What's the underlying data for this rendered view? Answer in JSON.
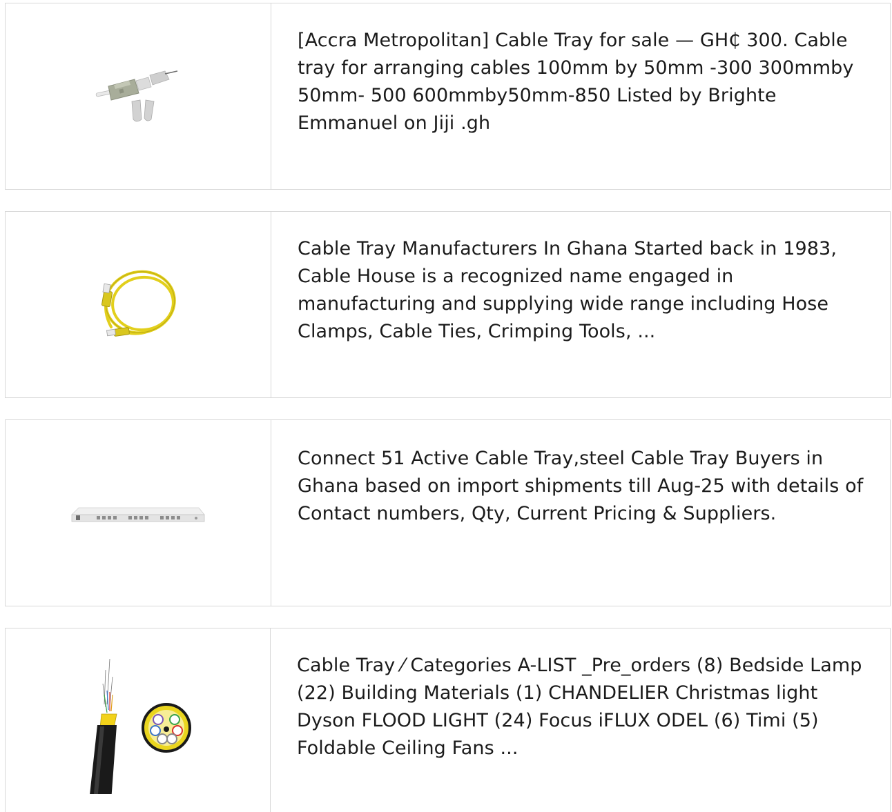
{
  "results": [
    {
      "thumbnail_icon": "fiber-connector-icon",
      "snippet": "[Accra Metropolitan] Cable Tray for sale — GH₵ 300. Cable tray for arranging cables 100mm by 50mm -300 300mmby 50mm- 500 600mmby50mm-850 Listed by Brighte Emmanuel on Jiji .gh"
    },
    {
      "thumbnail_icon": "yellow-patch-cable-icon",
      "snippet": "Cable Tray Manufacturers In Ghana Started back in 1983, Cable House is a recognized name engaged in manufacturing and supplying wide range including Hose Clamps, Cable Ties, Crimping Tools, ..."
    },
    {
      "thumbnail_icon": "rack-mount-panel-icon",
      "snippet": "Connect 51 Active Cable Tray,steel Cable Tray Buyers in Ghana based on import shipments till Aug-25 with details of Contact numbers, Qty, Current Pricing & Suppliers."
    },
    {
      "thumbnail_icon": "fiber-optic-cable-icon",
      "snippet": "Cable Tray ⁄ Categories A-LIST _Pre_orders (8) Bedside Lamp (22) Building Materials (1) CHANDELIER Christmas light Dyson FLOOD LIGHT (24) Focus iFLUX ODEL (6) Timi (5) Foldable Ceiling Fans ..."
    }
  ],
  "colors": {
    "border": "#d7d7d7",
    "text": "#1b1b1b",
    "cable_yellow": "#e8d51a",
    "cable_black": "#1a1a1a"
  }
}
